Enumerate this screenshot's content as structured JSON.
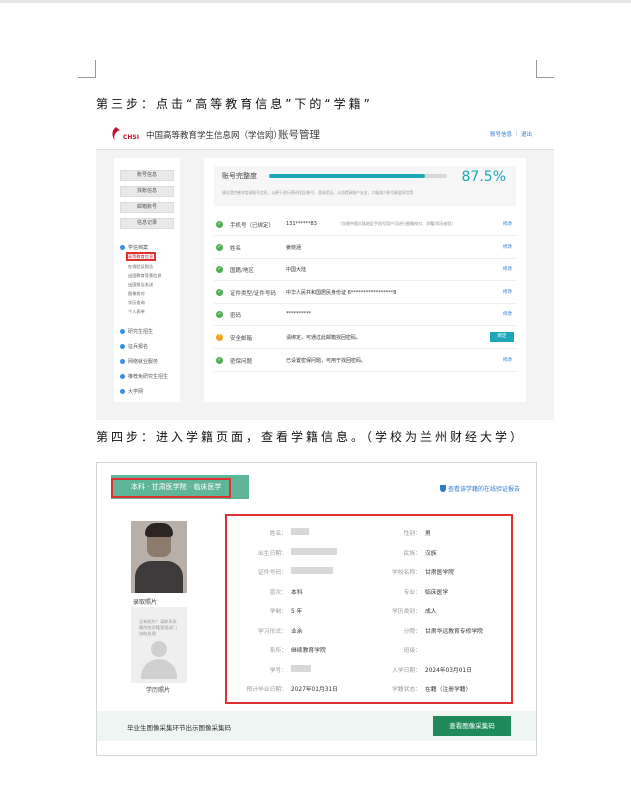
{
  "steps": {
    "step3": "第三步：点击“高等教育信息”下的“学籍”",
    "step4": "第四步：进入学籍页面，查看学籍信息。（学校为兰州财经大学）"
  },
  "account_page": {
    "logo_text": "CHSI",
    "site_name": "中国高等教育学生信息网（学信网）",
    "page_title": "账号管理",
    "header_links": "账号信息 ｜ 退出",
    "side_buttons": [
      "账号信息",
      "找账信息",
      "邮箱账号",
      "信息记录"
    ],
    "side_sections": [
      {
        "label": "学信档案",
        "items": [
          "高等教育信息",
          "在线验证报告",
          "出国教育背景信息",
          "出国报告发送",
          "图像校对",
          "学历查询",
          "个人表单"
        ]
      },
      {
        "label": "研究生招生",
        "items": []
      },
      {
        "label": "征兵报名",
        "items": []
      },
      {
        "label": "网络就业服务",
        "items": []
      },
      {
        "label": "推荐免研究生招生",
        "items": []
      },
      {
        "label": "大学网",
        "items": []
      }
    ],
    "completeness": {
      "title": "账号完整度",
      "percent": 87.5,
      "percent_text": "87.5%",
      "note": "建议您完善学信网账号信息，以便于进行密码找回/账号、登录验证。从而提高账户安全，大幅减少账号被盗风险等"
    },
    "rows": [
      {
        "icon": "check",
        "label": "手机号（已绑定）",
        "value": "131******83",
        "note": "（仅限中国大陆地区手机号用户可进行图像校对、学籍/学历核验）",
        "action": "修改"
      },
      {
        "icon": "check",
        "label": "姓名",
        "value": "姜晓涵",
        "note": "",
        "action": "修改"
      },
      {
        "icon": "check",
        "label": "国籍/地区",
        "value": "中国大陆",
        "note": "",
        "action": "修改"
      },
      {
        "icon": "check",
        "label": "证件类型/证件号码",
        "value": "中华人民共和国居民身份证    6*****************8",
        "note": "",
        "action": "修改"
      },
      {
        "icon": "check",
        "label": "密码",
        "value": "**********",
        "note": "",
        "action": "修改"
      },
      {
        "icon": "warn",
        "label": "安全邮箱",
        "value": "请绑定，可通过此邮箱找回密码。",
        "note": "",
        "action": "绑定"
      },
      {
        "icon": "check",
        "label": "密保问题",
        "value": "已设置密保问题，可用于找回密码。",
        "note": "",
        "action": "修改"
      }
    ]
  },
  "status_page": {
    "tab_label": "本科 · 甘肃医学院 · 临床医学",
    "verify_link": "查看该学籍的在线验证报告",
    "photo_caption_1": "录取照片",
    "photo_caption_2": "学历照片",
    "edu_photo_msg": "没有照片？请联系采集院校学籍管理部门协助处理",
    "fields": [
      {
        "label": "姓名：",
        "value": "",
        "blur": 18
      },
      {
        "label": "性别：",
        "value": "男"
      },
      {
        "label": "出生日期：",
        "value": "",
        "blur": 46
      },
      {
        "label": "民族：",
        "value": "汉族"
      },
      {
        "label": "证件号码：",
        "value": "",
        "blur": 42
      },
      {
        "label": "学校名称：",
        "value": "甘肃医学院"
      },
      {
        "label": "层次：",
        "value": "本科"
      },
      {
        "label": "专业：",
        "value": "临床医学"
      },
      {
        "label": "学制：",
        "value": "5 年"
      },
      {
        "label": "学历类别：",
        "value": "成人"
      },
      {
        "label": "学习形式：",
        "value": "业余"
      },
      {
        "label": "分院：",
        "value": "甘肃华远教育专修学院"
      },
      {
        "label": "系所：",
        "value": "继续教育学院"
      },
      {
        "label": "班级：",
        "value": ""
      },
      {
        "label": "学号：",
        "value": "",
        "blur": 20
      },
      {
        "label": "入学日期：",
        "value": "2024年03月01日"
      },
      {
        "label": "预计毕业日期：",
        "value": "2027年01月31日"
      },
      {
        "label": "学籍状态：",
        "value": "在籍（注册学籍）"
      }
    ],
    "bottom_text": "毕业生图像采集环节出示图像采集码",
    "bottom_button": "查看图像采集码"
  }
}
